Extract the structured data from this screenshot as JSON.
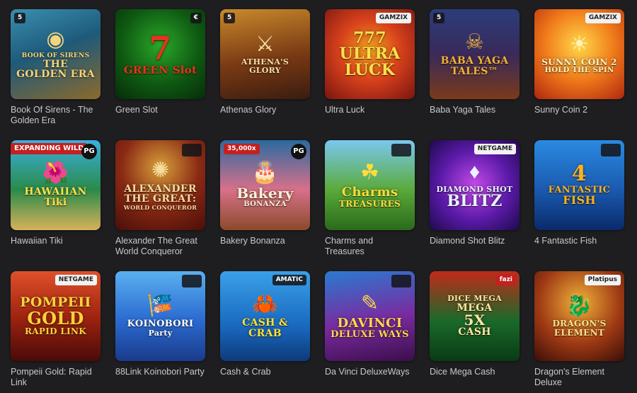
{
  "games": [
    {
      "title": "Book Of Sirens - The Golden Era",
      "art": {
        "lines": [
          "BOOK OF SIRENS",
          "THE",
          "GOLDEN ERA"
        ],
        "emblem": "◉",
        "bg": "linear-gradient(160deg,#3a8fb0 0%,#1e5a7a 45%,#8c6a2a 100%)",
        "color": "#f6d47a",
        "sizes": [
          9,
          14,
          14
        ]
      },
      "badge": {
        "text": "5",
        "style": "dark",
        "pos": "left"
      }
    },
    {
      "title": "Green Slot",
      "art": {
        "lines": [
          "7",
          "GREEN Slot"
        ],
        "emblem": "",
        "bg": "radial-gradient(circle at 50% 40%,#2aa82a 0%,#0f5a12 55%,#062c08 100%)",
        "color": "#e3341c",
        "sizes": [
          46,
          15
        ]
      },
      "badge": {
        "text": "€",
        "style": "dark",
        "pos": "right"
      }
    },
    {
      "title": "Athenas Glory",
      "art": {
        "lines": [
          "ATHENA'S GLORY"
        ],
        "emblem": "⚔",
        "bg": "linear-gradient(170deg,#c98a2c 0%,#7a3a14 55%,#3a1c10 100%)",
        "color": "#f7e2a8",
        "sizes": [
          11
        ]
      },
      "badge": {
        "text": "5",
        "style": "dark",
        "pos": "left"
      }
    },
    {
      "title": "Ultra Luck",
      "art": {
        "lines": [
          "777",
          "ULTRA",
          "LUCK"
        ],
        "emblem": "",
        "bg": "radial-gradient(circle at 50% 45%,#f2a21e 0%,#d8421c 45%,#7a1410 100%)",
        "color": "#ffe04a",
        "sizes": [
          22,
          22,
          22
        ]
      },
      "badge": {
        "text": "GAMZIX",
        "style": "light",
        "pos": "right"
      }
    },
    {
      "title": "Baba Yaga Tales",
      "art": {
        "lines": [
          "BABA YAGA",
          "TALES™"
        ],
        "emblem": "☠",
        "bg": "linear-gradient(180deg,#2a3c7a 0%,#3a2a5a 50%,#7a3a1a 100%)",
        "color": "#f3b23a",
        "sizes": [
          14,
          14
        ]
      },
      "badge": {
        "text": "5",
        "style": "dark",
        "pos": "left"
      }
    },
    {
      "title": "Sunny Coin 2",
      "art": {
        "lines": [
          "SUNNY COIN 2",
          "HOLD THE SPIN"
        ],
        "emblem": "☀",
        "bg": "radial-gradient(circle at 50% 40%,#ffd84a 0%,#f07a1a 50%,#b0260e 100%)",
        "color": "#fff3c2",
        "sizes": [
          12,
          10
        ]
      },
      "badge": {
        "text": "GAMZIX",
        "style": "light",
        "pos": "right"
      }
    },
    {
      "title": "Hawaiian Tiki",
      "art": {
        "lines": [
          "HAWAIIAN",
          "Tiki"
        ],
        "emblem": "🌺",
        "bg": "linear-gradient(180deg,#3ab0e0 0%,#2a8a4a 55%,#d8b25a 100%)",
        "color": "#ffe24a",
        "sizes": [
          14,
          14
        ]
      },
      "badge": {
        "text": "EXPANDING WILD",
        "style": "promo",
        "pos": "tag"
      },
      "badge2": {
        "text": "PG",
        "style": "pg",
        "pos": "right"
      }
    },
    {
      "title": "Alexander The Great World Conqueror",
      "art": {
        "lines": [
          "ALEXANDER",
          "THE GREAT:",
          "WORLD CONQUEROR"
        ],
        "emblem": "✺",
        "bg": "radial-gradient(circle at 50% 30%,#d8a03a 0%,#8a2a14 50%,#4a0e0a 100%)",
        "color": "#f6dca0",
        "sizes": [
          14,
          14,
          8
        ]
      },
      "badge": {
        "text": "",
        "style": "dark",
        "pos": "right"
      }
    },
    {
      "title": "Bakery Bonanza",
      "art": {
        "lines": [
          "Bakery",
          "BONANZA"
        ],
        "emblem": "🎂",
        "bg": "linear-gradient(180deg,#2a6aa0 0%,#d8708a 55%,#8a4a2a 100%)",
        "color": "#fff1d0",
        "sizes": [
          20,
          10
        ]
      },
      "badge": {
        "text": "35,000x",
        "style": "promo",
        "pos": "left"
      },
      "badge2": {
        "text": "PG",
        "style": "pg",
        "pos": "right"
      }
    },
    {
      "title": "Charms and Treasures",
      "art": {
        "lines": [
          "Charms",
          "TREASURES"
        ],
        "emblem": "☘",
        "bg": "linear-gradient(180deg,#7ac8f0 0%,#5aaa3a 55%,#2a6a1a 100%)",
        "color": "#ffdc3a",
        "sizes": [
          18,
          12
        ]
      },
      "badge": {
        "text": "",
        "style": "dark",
        "pos": "right"
      }
    },
    {
      "title": "Diamond Shot Blitz",
      "art": {
        "lines": [
          "DIAMOND SHOT",
          "BLITZ"
        ],
        "emblem": "♦",
        "bg": "radial-gradient(circle at 50% 50%,#c44ae8 0%,#5a1aa8 55%,#1e0a4a 100%)",
        "color": "#eaf2ff",
        "sizes": [
          11,
          22
        ]
      },
      "badge": {
        "text": "NETGAME",
        "style": "light",
        "pos": "right"
      }
    },
    {
      "title": "4 Fantastic Fish",
      "art": {
        "lines": [
          "4",
          "FANTASTIC",
          "FISH"
        ],
        "emblem": "",
        "bg": "linear-gradient(180deg,#2a8ae0 0%,#1a5ab0 55%,#0a2a6a 100%)",
        "color": "#ffb21a",
        "sizes": [
          30,
          13,
          16
        ]
      },
      "badge": {
        "text": "",
        "style": "dark",
        "pos": "right"
      }
    },
    {
      "title": "Pompeii Gold: Rapid Link",
      "art": {
        "lines": [
          "POMPEII",
          "GOLD",
          "RAPID LINK"
        ],
        "emblem": "",
        "bg": "linear-gradient(180deg,#e0502a 0%,#a02410 50%,#4a0a08 100%)",
        "color": "#ffd23a",
        "sizes": [
          19,
          24,
          12
        ]
      },
      "badge": {
        "text": "NETGAME",
        "style": "light",
        "pos": "right"
      }
    },
    {
      "title": "88Link Koinobori Party",
      "art": {
        "lines": [
          "KOINOBORI",
          "Party"
        ],
        "emblem": "🎏",
        "bg": "linear-gradient(180deg,#5ab0f0 0%,#2a6ad0 55%,#1a3a8a 100%)",
        "color": "#ffffff",
        "sizes": [
          13,
          11
        ]
      },
      "badge": {
        "text": "",
        "style": "dark",
        "pos": "right"
      }
    },
    {
      "title": "Cash & Crab",
      "art": {
        "lines": [
          "CASH & CRAB"
        ],
        "emblem": "🦀",
        "bg": "linear-gradient(180deg,#3aa0e8 0%,#1a6ac0 60%,#0e3a7a 100%)",
        "color": "#ffe23a",
        "sizes": [
          14
        ]
      },
      "badge": {
        "text": "AMATIC",
        "style": "dark",
        "pos": "right"
      }
    },
    {
      "title": "Da Vinci DeluxeWays",
      "art": {
        "lines": [
          "DAVINCI",
          "DELUXE WAYS"
        ],
        "emblem": "✎",
        "bg": "linear-gradient(170deg,#2a7ad0 0%,#7a2aa0 55%,#3a0e4a 100%)",
        "color": "#ffd84a",
        "sizes": [
          18,
          13
        ]
      },
      "badge": {
        "text": "",
        "style": "dark",
        "pos": "right"
      }
    },
    {
      "title": "Dice Mega Cash",
      "art": {
        "lines": [
          "DICE MEGA",
          "MEGA",
          "5X",
          "CASH"
        ],
        "emblem": "",
        "bg": "linear-gradient(180deg,#c02a1a 0%,#1a6a2a 55%,#0a3a14 100%)",
        "color": "#ffe6a0",
        "sizes": [
          11,
          14,
          20,
          14
        ]
      },
      "badge": {
        "text": "fazi",
        "style": "promo",
        "pos": "right"
      }
    },
    {
      "title": "Dragon's Element Deluxe",
      "art": {
        "lines": [
          "DRAGON'S",
          "ELEMENT"
        ],
        "emblem": "🐉",
        "bg": "radial-gradient(circle at 50% 35%,#f0b23a 0%,#a03a14 55%,#3a0e08 100%)",
        "color": "#ffe08a",
        "sizes": [
          12,
          12
        ]
      },
      "badge": {
        "text": "Platipus",
        "style": "light",
        "pos": "right"
      }
    }
  ]
}
